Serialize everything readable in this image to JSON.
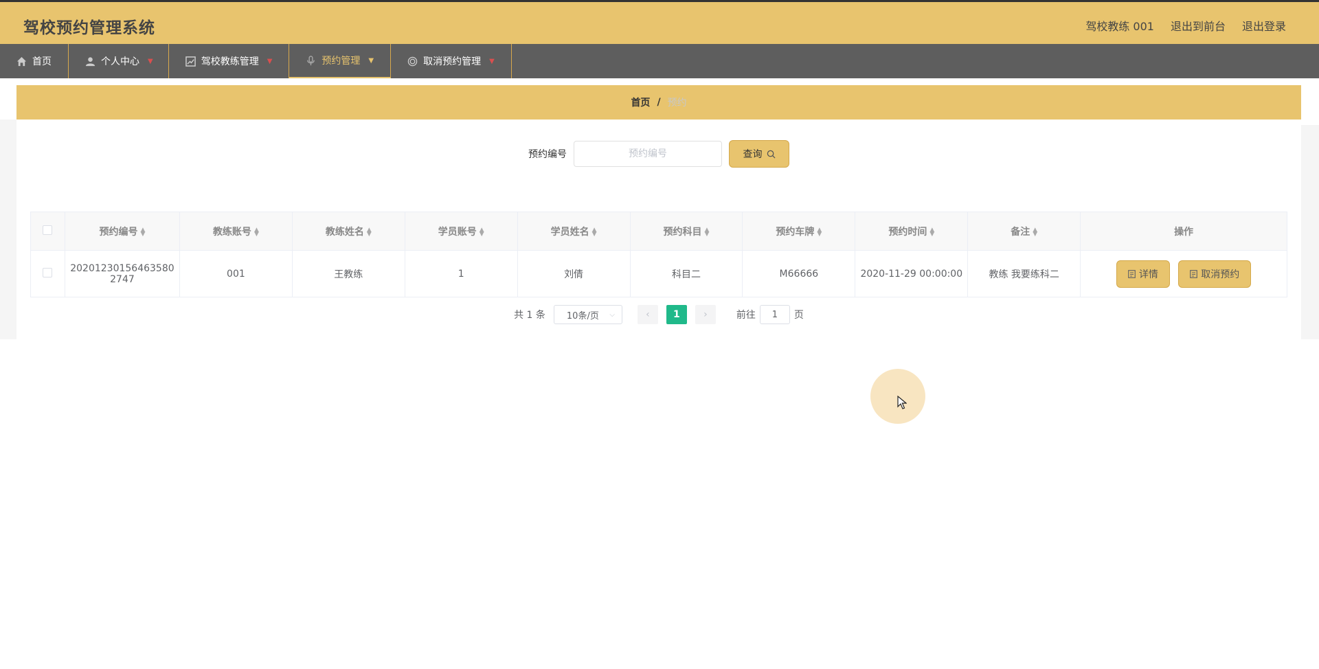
{
  "header": {
    "title": "驾校预约管理系统",
    "user_label": "驾校教练 001",
    "front_label": "退出到前台",
    "logout_label": "退出登录"
  },
  "nav": {
    "items": [
      {
        "label": "首页",
        "icon": "home-icon"
      },
      {
        "label": "个人中心",
        "icon": "user-icon"
      },
      {
        "label": "驾校教练管理",
        "icon": "chart-icon"
      },
      {
        "label": "预约管理",
        "icon": "microphone-icon",
        "active": true
      },
      {
        "label": "取消预约管理",
        "icon": "target-icon"
      }
    ]
  },
  "breadcrumb": {
    "home": "首页",
    "separator": "/",
    "current": "预约"
  },
  "search": {
    "label": "预约编号",
    "placeholder": "预约编号",
    "button_label": "查询"
  },
  "table": {
    "columns": [
      "预约编号",
      "教练账号",
      "教练姓名",
      "学员账号",
      "学员姓名",
      "预约科目",
      "预约车牌",
      "预约时间",
      "备注",
      "操作"
    ],
    "rows": [
      {
        "id_line1": "20201230156463580",
        "id_line2": "2747",
        "coach_account": "001",
        "coach_name": "王教练",
        "student_account": "1",
        "student_name": "刘倩",
        "subject": "科目二",
        "plate": "M66666",
        "time": "2020-11-29 00:00:00",
        "note": "教练 我要练科二"
      }
    ],
    "detail_label": "详情",
    "cancel_label": "取消预约"
  },
  "pagination": {
    "total_text": "共 1 条",
    "page_size": "10条/页",
    "current_page": "1",
    "goto_label": "前往",
    "goto_value": "1",
    "page_suffix": "页"
  },
  "colors": {
    "accent": "#e8c46e",
    "nav_bg": "#5e5e5e",
    "pager_active": "#20b98a"
  }
}
